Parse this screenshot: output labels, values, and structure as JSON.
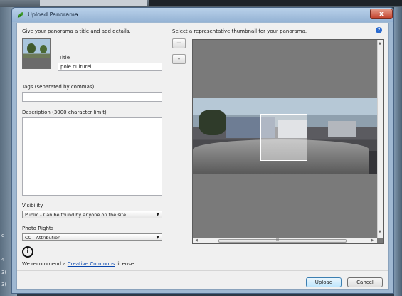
{
  "window": {
    "title": "Upload Panorama",
    "close_label": "x"
  },
  "left": {
    "intro": "Give your panorama a title and add details.",
    "title_label": "Title",
    "title_value": "pole culturel",
    "tags_label": "Tags (separated by commas)",
    "tags_value": "",
    "description_label": "Description (3000 character limit)",
    "description_value": "",
    "visibility_label": "Visibility",
    "visibility_value": "Public - Can be found by anyone on the site",
    "rights_label": "Photo Rights",
    "rights_value": "CC - Attribution",
    "cc_icon_glyph": "i",
    "recommend_prefix": "We recommend a ",
    "recommend_link": "Creative Commons",
    "recommend_suffix": " license."
  },
  "right": {
    "thumb_prompt": "Select a representative thumbnail for your panorama.",
    "zoom_in": "+",
    "zoom_out": "-",
    "help_glyph": "?",
    "scroll_grip": "III"
  },
  "buttons": {
    "upload": "Upload",
    "cancel": "Cancel"
  },
  "background": {
    "left_edge_texts": [
      "c",
      "4",
      "3(",
      "3("
    ]
  },
  "icons": {
    "app": "panorama-leaf-icon",
    "close": "close-icon",
    "help": "help-icon",
    "cc": "creative-commons-attribution-icon",
    "dropdown": "chevron-down-icon"
  }
}
